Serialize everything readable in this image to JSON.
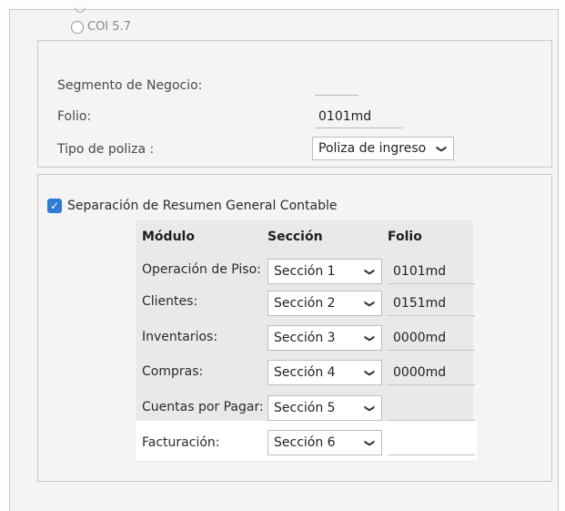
{
  "coi_option": "COI 5.7",
  "form": {
    "segmento_label": "Segmento de Negocio:",
    "folio_label": "Folio:",
    "folio_value": "0101md",
    "tipo_label": "Tipo de poliza :",
    "tipo_value": "Poliza de ingreso"
  },
  "separacion": {
    "checkbox_label": "Separación de Resumen General Contable",
    "checked": true,
    "headers": {
      "modulo": "Módulo",
      "seccion": "Sección",
      "folio": "Folio"
    },
    "rows": [
      {
        "modulo": "Operación de Piso:",
        "seccion": "Sección 1",
        "folio": "0101md"
      },
      {
        "modulo": "Clientes:",
        "seccion": "Sección 2",
        "folio": "0151md"
      },
      {
        "modulo": "Inventarios:",
        "seccion": "Sección 3",
        "folio": "0000md"
      },
      {
        "modulo": "Compras:",
        "seccion": "Sección 4",
        "folio": "0000md"
      },
      {
        "modulo": "Cuentas por Pagar:",
        "seccion": "Sección 5",
        "folio": ""
      },
      {
        "modulo": "Facturación:",
        "seccion": "Sección 6",
        "folio": ""
      }
    ]
  }
}
